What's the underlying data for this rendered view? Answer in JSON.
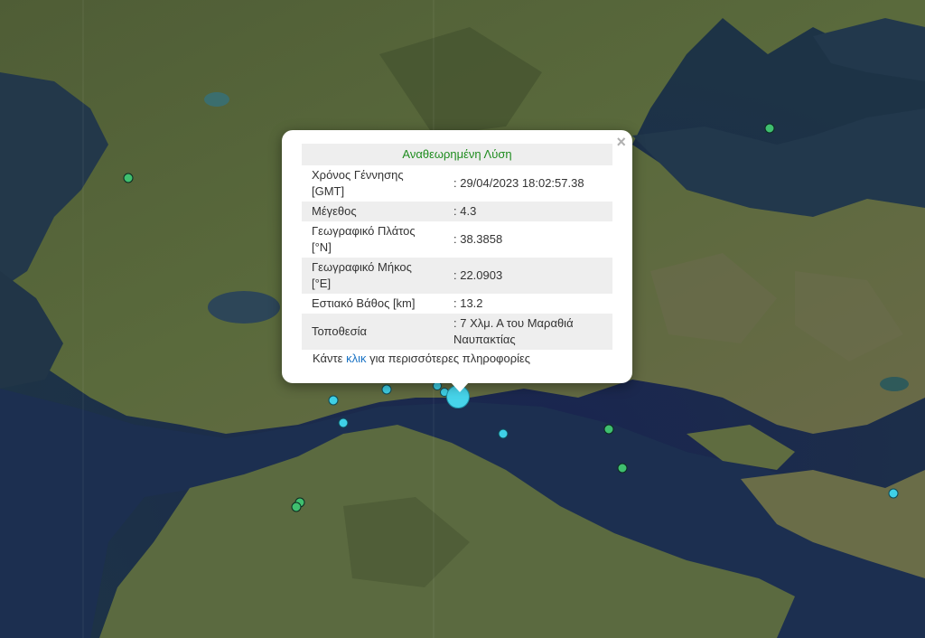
{
  "popup": {
    "title": "Αναθεωρημένη Λύση",
    "close_symbol": "×",
    "rows": [
      {
        "label": "Χρόνος Γέννησης [GMT]",
        "value": ": 29/04/2023 18:02:57.38"
      },
      {
        "label": "Μέγεθος",
        "value": ": 4.3"
      },
      {
        "label": "Γεωγραφικό Πλάτος [°N]",
        "value": ": 38.3858"
      },
      {
        "label": "Γεωγραφικό Μήκος [°E]",
        "value": ": 22.0903"
      },
      {
        "label": "Εστιακό Βάθος [km]",
        "value": ": 13.2"
      },
      {
        "label": "Τοποθεσία",
        "value": ": 7 Χλμ. Α του Μαραθιά Ναυπακτίας"
      }
    ],
    "more_prefix": "Κάντε ",
    "more_link": "κλικ",
    "more_suffix": " για περισσότερες πληροφορίες"
  },
  "colors": {
    "marker_green": "#3fbf6f",
    "marker_cyan": "#3fd0e6",
    "title_green": "#1f8c1f",
    "link_blue": "#1a73c4"
  }
}
